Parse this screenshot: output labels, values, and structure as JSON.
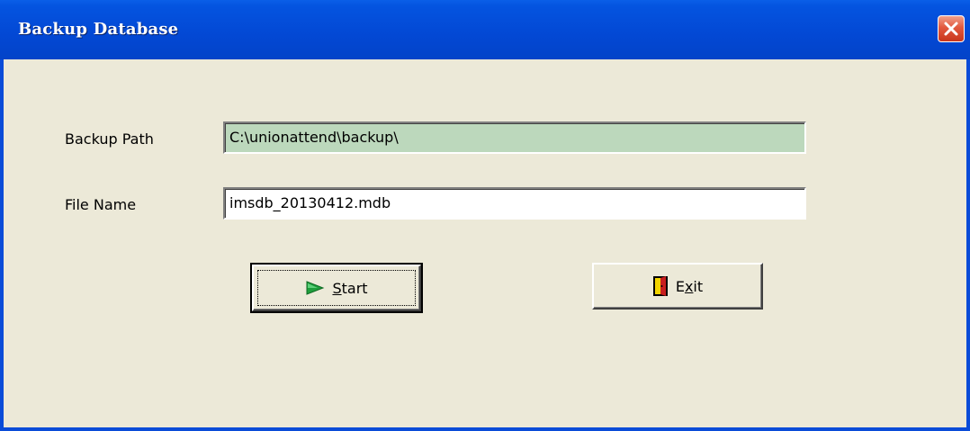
{
  "window": {
    "title": "Backup Database",
    "close_label": "×"
  },
  "form": {
    "backup_path_label": "Backup Path",
    "backup_path_value": "C:\\unionattend\\backup\\",
    "file_name_label": "File Name",
    "file_name_value": "imsdb_20130412.mdb"
  },
  "buttons": {
    "start": {
      "label_mnemonic": "S",
      "label_rest": "tart",
      "icon": "play-arrow-icon"
    },
    "exit": {
      "label_first": "E",
      "label_mnemonic": "x",
      "label_rest": "it",
      "icon": "door-icon"
    }
  },
  "colors": {
    "titlebar": "#0348d4",
    "dialog_bg": "#ece9d8",
    "readonly_field_bg": "#bcd8bc",
    "field_bg": "#ffffff",
    "close_button": "#e2583e",
    "play_icon": "#1f9e3c"
  }
}
